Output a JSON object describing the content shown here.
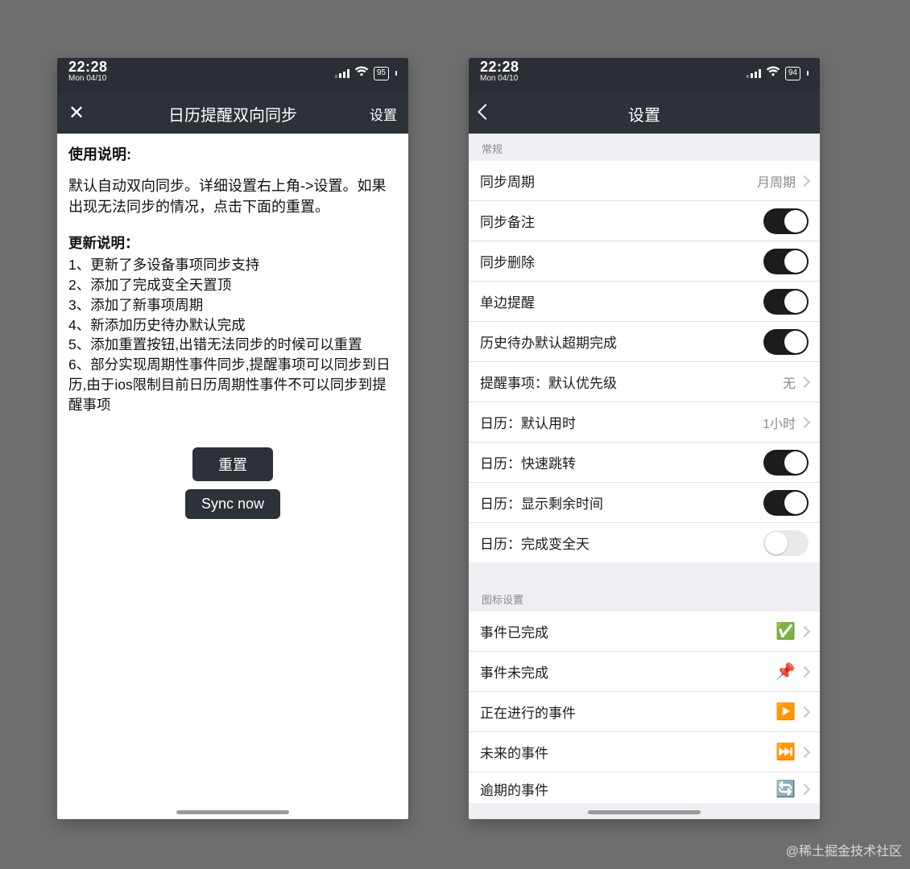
{
  "watermark": "@稀土掘金技术社区",
  "status": {
    "time": "22:28",
    "date": "Mon 04/10",
    "battery_left": "95",
    "battery_right": "94"
  },
  "left": {
    "nav": {
      "title": "日历提醒双向同步",
      "right_action": "设置"
    },
    "usage_heading": "使用说明:",
    "usage_para": "默认自动双向同步。详细设置右上角->设置。如果出现无法同步的情况，点击下面的重置。",
    "updates_heading": "更新说明：",
    "updates": [
      "1、更新了多设备事项同步支持",
      "2、添加了完成变全天置顶",
      "3、添加了新事项周期",
      "4、新添加历史待办默认完成",
      "5、添加重置按钮,出错无法同步的时候可以重置",
      "6、部分实现周期性事件同步,提醒事项可以同步到日历,由于ios限制目前日历周期性事件不可以同步到提醒事项"
    ],
    "buttons": {
      "reset": "重置",
      "sync_now": "Sync now"
    }
  },
  "right": {
    "nav": {
      "title": "设置"
    },
    "sections": {
      "general": {
        "header": "常规",
        "rows": [
          {
            "key": "sync_period",
            "label": "同步周期",
            "value": "月周期",
            "type": "nav"
          },
          {
            "key": "sync_notes",
            "label": "同步备注",
            "type": "toggle",
            "on": true
          },
          {
            "key": "sync_delete",
            "label": "同步删除",
            "type": "toggle",
            "on": true
          },
          {
            "key": "one_side_remind",
            "label": "单边提醒",
            "type": "toggle",
            "on": true
          },
          {
            "key": "history_overdue_done",
            "label": "历史待办默认超期完成",
            "type": "toggle",
            "on": true
          },
          {
            "key": "reminder_default_priority",
            "label": "提醒事项：默认优先级",
            "value": "无",
            "type": "nav"
          },
          {
            "key": "calendar_default_duration",
            "label": "日历：默认用时",
            "value": "1小时",
            "type": "nav"
          },
          {
            "key": "calendar_quick_jump",
            "label": "日历：快速跳转",
            "type": "toggle",
            "on": true
          },
          {
            "key": "calendar_show_remaining",
            "label": "日历：显示剩余时间",
            "type": "toggle",
            "on": true
          },
          {
            "key": "calendar_done_full_day",
            "label": "日历：完成变全天",
            "type": "toggle",
            "on": false
          }
        ]
      },
      "icons": {
        "header": "图标设置",
        "rows": [
          {
            "key": "event_done",
            "label": "事件已完成",
            "icon": "✅",
            "type": "nav"
          },
          {
            "key": "event_undone",
            "label": "事件未完成",
            "icon": "📌",
            "type": "nav"
          },
          {
            "key": "event_in_progress",
            "label": "正在进行的事件",
            "icon": "▶️",
            "type": "nav"
          },
          {
            "key": "event_future",
            "label": "未来的事件",
            "icon": "⏭️",
            "type": "nav"
          },
          {
            "key": "event_overdue",
            "label": "逾期的事件",
            "icon": "🔄",
            "type": "nav",
            "partial": true
          }
        ]
      }
    }
  }
}
